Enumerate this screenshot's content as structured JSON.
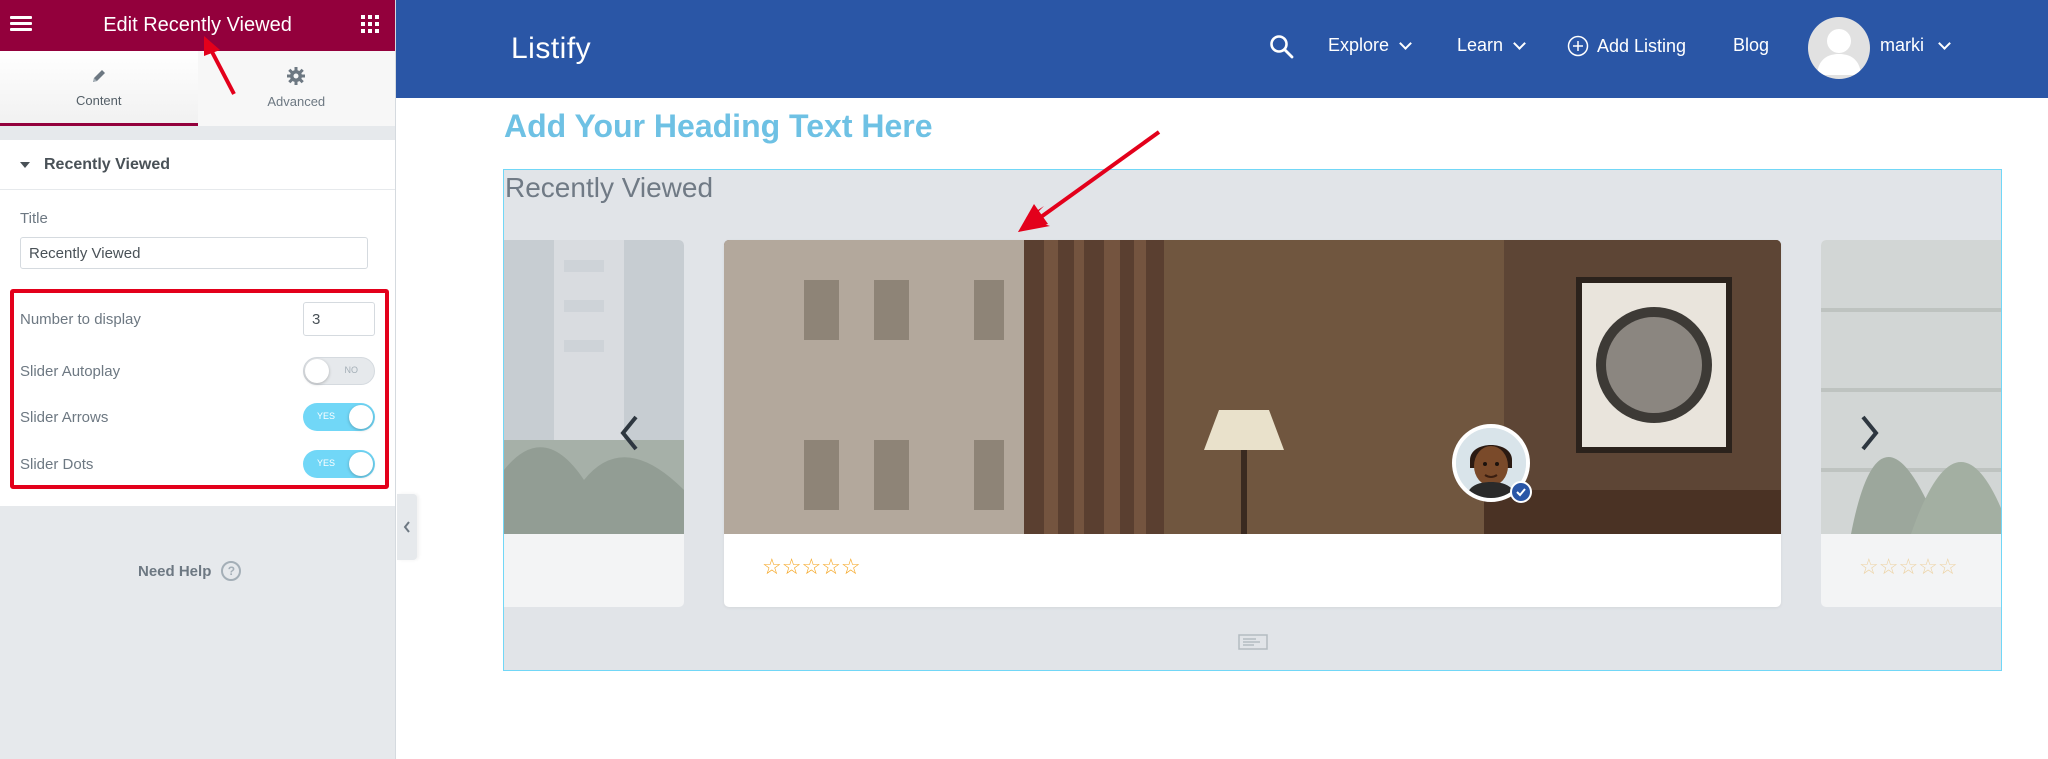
{
  "editor": {
    "header_title": "Edit Recently Viewed",
    "tabs": [
      {
        "label": "Content",
        "icon": "pencil-icon",
        "active": true
      },
      {
        "label": "Advanced",
        "icon": "gear-icon",
        "active": false
      }
    ],
    "section_title": "Recently Viewed",
    "fields": {
      "title_label": "Title",
      "title_value": "Recently Viewed",
      "number_label": "Number to display",
      "number_value": "3",
      "autoplay_label": "Slider Autoplay",
      "autoplay_state": "NO",
      "arrows_label": "Slider Arrows",
      "arrows_state": "YES",
      "dots_label": "Slider Dots",
      "dots_state": "YES"
    },
    "need_help": "Need Help",
    "help_glyph": "?",
    "colors": {
      "header": "#93003c",
      "toggle_on": "#71d7f7",
      "highlight": "#e3001b"
    }
  },
  "site": {
    "logo": "Listify",
    "nav": {
      "explore": "Explore",
      "learn": "Learn",
      "add_listing": "Add Listing",
      "blog": "Blog",
      "user": "marki"
    },
    "heading": "Add Your Heading Text Here",
    "widget_title": "Recently Viewed",
    "stars_main": "☆☆☆☆☆",
    "stars_right": "☆☆☆☆☆",
    "colors": {
      "header": "#2a56a6",
      "heading": "#6ec1e4",
      "stars": "#f5a623"
    }
  }
}
